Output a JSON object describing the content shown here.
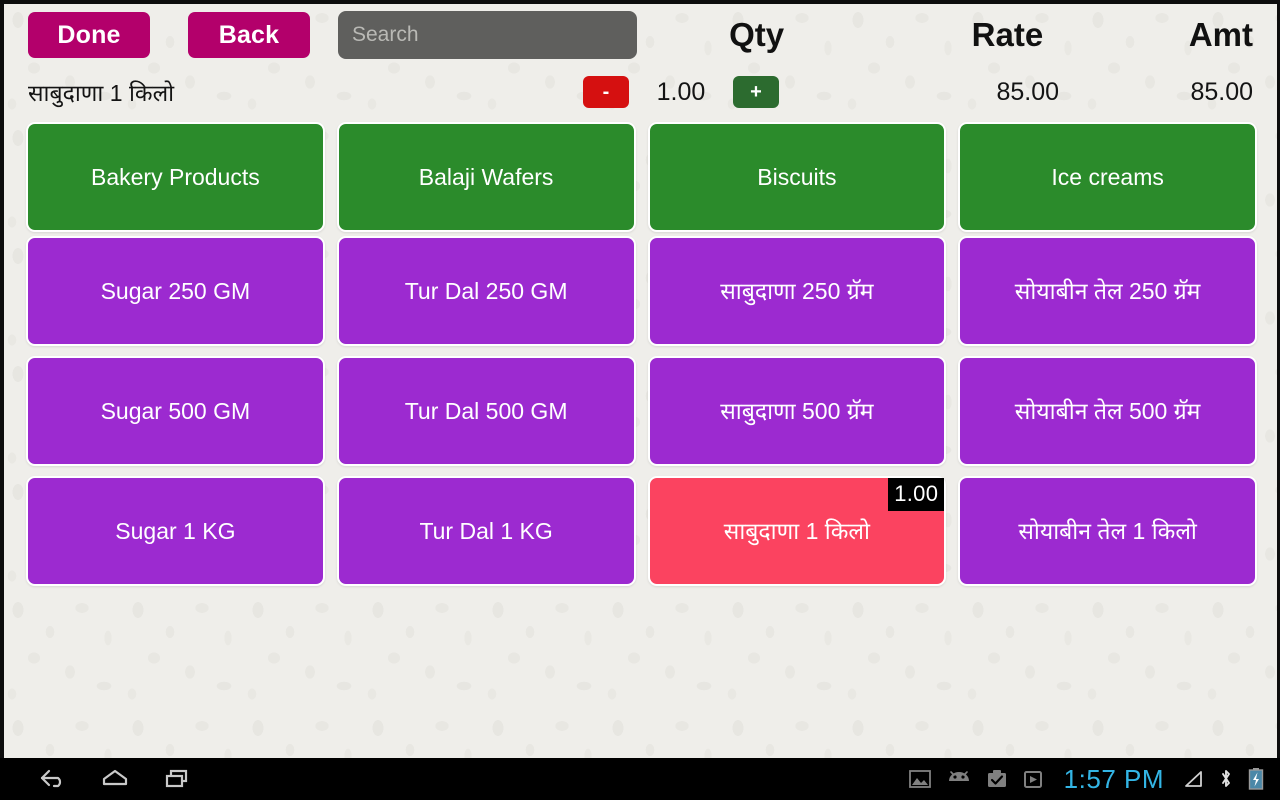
{
  "toolbar": {
    "done_label": "Done",
    "back_label": "Back",
    "search_placeholder": "Search",
    "search_value": ""
  },
  "columns": {
    "qty_header": "Qty",
    "rate_header": "Rate",
    "amt_header": "Amt"
  },
  "line_item": {
    "name": "साबुदाणा 1 किलो",
    "minus_label": "-",
    "plus_label": "+",
    "qty": "1.00",
    "rate": "85.00",
    "amount": "85.00"
  },
  "categories": [
    {
      "label": "Bakery Products"
    },
    {
      "label": "Balaji Wafers"
    },
    {
      "label": "Biscuits"
    },
    {
      "label": "Ice creams"
    }
  ],
  "products": [
    {
      "label": "Sugar 250 GM",
      "selected": false,
      "badge": ""
    },
    {
      "label": "Tur Dal 250 GM",
      "selected": false,
      "badge": ""
    },
    {
      "label": "साबुदाणा 250 ग्रॅम",
      "selected": false,
      "badge": ""
    },
    {
      "label": "सोयाबीन तेल 250 ग्रॅम",
      "selected": false,
      "badge": ""
    },
    {
      "label": "Sugar 500 GM",
      "selected": false,
      "badge": ""
    },
    {
      "label": "Tur Dal 500 GM",
      "selected": false,
      "badge": ""
    },
    {
      "label": "साबुदाणा 500 ग्रॅम",
      "selected": false,
      "badge": ""
    },
    {
      "label": "सोयाबीन तेल 500 ग्रॅम",
      "selected": false,
      "badge": ""
    },
    {
      "label": "Sugar 1 KG",
      "selected": false,
      "badge": ""
    },
    {
      "label": "Tur Dal 1 KG",
      "selected": false,
      "badge": ""
    },
    {
      "label": "साबुदाणा 1 किलो",
      "selected": true,
      "badge": "1.00"
    },
    {
      "label": "सोयाबीन तेल 1 किलो",
      "selected": false,
      "badge": ""
    }
  ],
  "system_bar": {
    "nav": [
      {
        "icon": "back-icon"
      },
      {
        "icon": "home-icon"
      },
      {
        "icon": "recents-icon"
      }
    ],
    "status_icons": [
      "image-icon",
      "android-icon",
      "briefcase-check-icon",
      "play-store-icon"
    ],
    "clock": "1:57 PM",
    "right_icons": [
      "signal-icon",
      "bluetooth-icon",
      "battery-charging-icon"
    ]
  },
  "colors": {
    "brand_magenta": "#b3006b",
    "category_green": "#2b8b2b",
    "product_purple": "#9c2ad0",
    "selected_red": "#fb4360",
    "minus_red": "#d51010",
    "plus_green": "#2c6b2f",
    "clock_cyan": "#33b5e5",
    "app_background": "#efeeea"
  }
}
